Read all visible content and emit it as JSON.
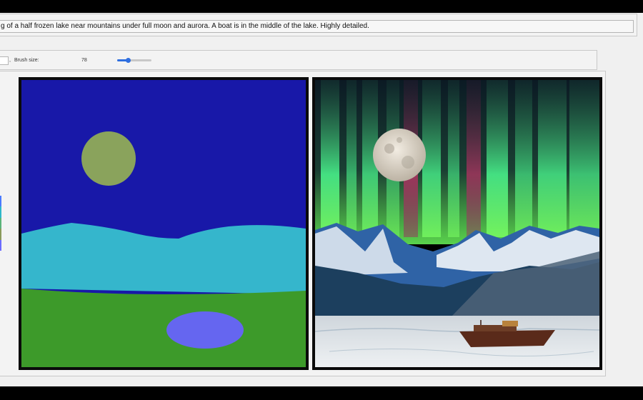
{
  "prompt": {
    "value": "g of a half frozen lake near mountains under full moon and aurora. A boat is in the middle of the lake. Highly detailed."
  },
  "toolbar": {
    "separator": ",",
    "brush_size_label": "Brush size:",
    "brush_size_value": "78",
    "brush_slider_fraction": 0.32
  },
  "palette_colors": [
    "#4a7bff",
    "#2fb7c9",
    "#5ab37a",
    "#8a9a5b",
    "#6b6bff"
  ],
  "sketch_colors": {
    "sky": "#1818a8",
    "moon": "#8aa35c",
    "mountains": "#35b6cc",
    "ground": "#3d9a2a",
    "lake": "#6566f0"
  },
  "accent_color": "#2f6fe0"
}
